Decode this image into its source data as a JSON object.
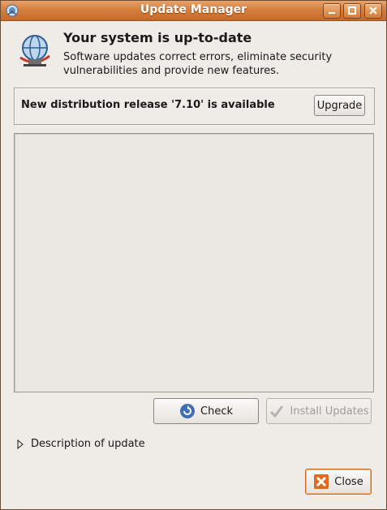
{
  "window": {
    "title": "Update Manager"
  },
  "header": {
    "heading": "Your system is up-to-date",
    "description": "Software updates correct errors, eliminate security vulnerabilities and provide new features."
  },
  "release": {
    "message": "New distribution release '7.10' is available",
    "upgrade_label": "Upgrade"
  },
  "actions": {
    "check_label": "Check",
    "install_label": "Install Updates",
    "close_label": "Close"
  },
  "expander": {
    "label": "Description of update"
  },
  "colors": {
    "titlebar": "#d57f3d",
    "background": "#efebe7",
    "close_icon": "#e06b1f"
  },
  "icons": [
    "update-manager-icon",
    "minimize-icon",
    "maximize-icon",
    "close-icon",
    "network-globe-icon",
    "refresh-icon",
    "checkmark-icon",
    "expander-arrow-icon",
    "close-x-icon"
  ]
}
